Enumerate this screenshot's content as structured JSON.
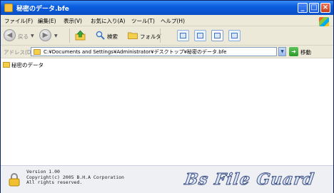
{
  "window": {
    "title": "秘密のデータ.bfe",
    "buttons": {
      "minimize": "_",
      "maximize": "□",
      "close": "×"
    }
  },
  "menubar": {
    "items": [
      "ファイル(F)",
      "編集(E)",
      "表示(V)",
      "お気に入り(A)",
      "ツール(T)",
      "ヘルプ(H)"
    ]
  },
  "toolbar": {
    "back_label": "戻る",
    "search_label": "検索",
    "folders_label": "フォルダ"
  },
  "address": {
    "label": "アドレス(D)",
    "value": "C:¥Documents and Settings¥Administrator¥デスクトップ¥秘密のデータ.bfe",
    "go_label": "移動"
  },
  "content": {
    "items": [
      {
        "name": "秘密のデータ",
        "icon": "folder-icon"
      }
    ]
  },
  "footer": {
    "version": "Version 1.00",
    "copyright": "Copyright(c) 2005 B.H.A Corporation",
    "rights": "All rights reserved.",
    "brand": "Bs File Guard"
  },
  "colors": {
    "titlebar": "#0a5ee0",
    "accent": "#3b4f85",
    "folder": "#f4cf4a"
  }
}
